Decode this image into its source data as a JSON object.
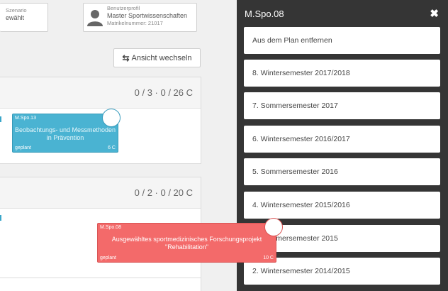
{
  "header": {
    "scenario_label": "Szenario",
    "scenario_value": "ewählt",
    "profile_label": "Benutzerprofil",
    "profile_program": "Master Sportwissenschaften",
    "profile_matrikel": "Matrikelnummer: 21017",
    "avatar_icon": "user-icon"
  },
  "toolbar": {
    "switch_icon": "swap-icon",
    "switch_glyph": "⇆",
    "switch_label": "Ansicht wechseln"
  },
  "semesters": [
    {
      "credits": "0 / 3 · 0 / 26 C"
    },
    {
      "credits": "0 / 2 · 0 / 20 C"
    }
  ],
  "modules": {
    "spo13": {
      "code": "M.Spo.13",
      "title": "Beobachtungs- und Messmethoden in Prävention",
      "status": "geplant",
      "credits": "6 C",
      "color": "#4ab3d2"
    },
    "spo08": {
      "code": "M.Spo.08",
      "title": "Ausgewähltes sportmedizinisches Forschungsprojekt \"Rehabilitation\"",
      "status": "geplant",
      "credits": "10 C",
      "color": "#f36a6a"
    }
  },
  "sidebar": {
    "title": "M.Spo.08",
    "close_glyph": "✖",
    "close_icon": "close-icon",
    "items": [
      {
        "label": "Aus dem Plan entfernen"
      },
      {
        "label": "8. Wintersemester 2017/2018"
      },
      {
        "label": "7. Sommersemester 2017"
      },
      {
        "label": "6. Wintersemester 2016/2017"
      },
      {
        "label": "5. Sommersemester 2016"
      },
      {
        "label": "4. Wintersemester 2015/2016"
      },
      {
        "label": "3. Sommersemester 2015"
      },
      {
        "label": "2. Wintersemester 2014/2015"
      }
    ]
  },
  "colors": {
    "sidebar_bg": "#353535",
    "module_blue": "#4ab3d2",
    "module_red": "#f36a6a"
  }
}
